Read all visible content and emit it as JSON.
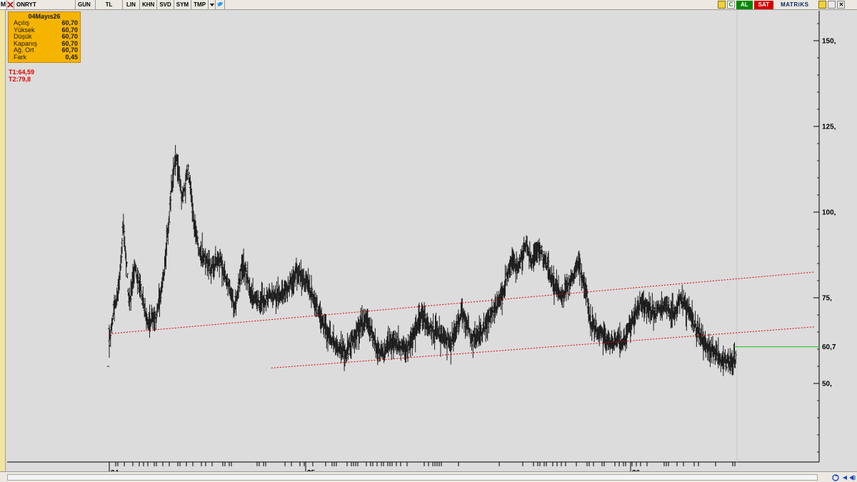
{
  "toolbar": {
    "m_label": "M",
    "symbol": "ONRYT",
    "period": "GUN",
    "currency": "TL",
    "scale": "LIN",
    "buttons": [
      "KHN",
      "SVD",
      "SYM",
      "TMP"
    ],
    "c_label": "C",
    "buy_label": "AL",
    "sell_label": "SAT",
    "brand": "MATRiKS"
  },
  "info_box": {
    "date": "04Mayıs26",
    "rows": [
      {
        "label": "Açılış",
        "value": "60,70"
      },
      {
        "label": "Yüksek",
        "value": "60,70"
      },
      {
        "label": "Düşük",
        "value": "60,70"
      },
      {
        "label": "Kapanış",
        "value": "60,70"
      },
      {
        "label": "Ağ. Ort",
        "value": "60,70"
      },
      {
        "label": "Fark",
        "value": "0,45"
      }
    ]
  },
  "targets": [
    "T1:64,59",
    "T2:79,8"
  ],
  "colors": {
    "bars": "#1a1a1a",
    "trendline": "#e00000",
    "last_price_line": "#22c022",
    "info_box": "#f5b400",
    "buy": "#008a00",
    "sell": "#d80000",
    "background": "#dcdcdc"
  },
  "chart_data": {
    "type": "ohlc",
    "y_ticks": [
      {
        "value": 150,
        "label": "150,"
      },
      {
        "value": 125,
        "label": "125,"
      },
      {
        "value": 100,
        "label": "100,"
      },
      {
        "value": 75,
        "label": "75,"
      },
      {
        "value": 50,
        "label": "50,"
      }
    ],
    "last_price": {
      "value": 60.7,
      "label": "60,7"
    },
    "x_labels": [
      {
        "label": "24",
        "t": 0.0
      },
      {
        "label": "25",
        "t": 1.0
      },
      {
        "label": "26",
        "t": 2.0
      }
    ],
    "ylim": [
      27,
      160
    ],
    "xlim": [
      0.0,
      3.1
    ],
    "price_path": [
      [
        0.0,
        63
      ],
      [
        0.05,
        80
      ],
      [
        0.07,
        97
      ],
      [
        0.1,
        73
      ],
      [
        0.13,
        84
      ],
      [
        0.16,
        76
      ],
      [
        0.19,
        68
      ],
      [
        0.23,
        69
      ],
      [
        0.27,
        82
      ],
      [
        0.31,
        108
      ],
      [
        0.33,
        116
      ],
      [
        0.36,
        103
      ],
      [
        0.39,
        112
      ],
      [
        0.42,
        96
      ],
      [
        0.45,
        88
      ],
      [
        0.5,
        84
      ],
      [
        0.55,
        86
      ],
      [
        0.58,
        80
      ],
      [
        0.62,
        72
      ],
      [
        0.66,
        86
      ],
      [
        0.7,
        76
      ],
      [
        0.74,
        74
      ],
      [
        0.8,
        76
      ],
      [
        0.84,
        75
      ],
      [
        0.88,
        77
      ],
      [
        0.93,
        83
      ],
      [
        0.97,
        80
      ],
      [
        1.02,
        73
      ],
      [
        1.07,
        66
      ],
      [
        1.12,
        61
      ],
      [
        1.17,
        59
      ],
      [
        1.22,
        65
      ],
      [
        1.27,
        69
      ],
      [
        1.31,
        62
      ],
      [
        1.35,
        58
      ],
      [
        1.4,
        63
      ],
      [
        1.44,
        60
      ],
      [
        1.49,
        62
      ],
      [
        1.54,
        70
      ],
      [
        1.59,
        66
      ],
      [
        1.63,
        64
      ],
      [
        1.69,
        62
      ],
      [
        1.74,
        71
      ],
      [
        1.79,
        64
      ],
      [
        1.84,
        65
      ],
      [
        1.89,
        70
      ],
      [
        1.94,
        76
      ],
      [
        1.98,
        85
      ],
      [
        2.02,
        84
      ],
      [
        2.06,
        91
      ],
      [
        2.08,
        85
      ],
      [
        2.12,
        90
      ],
      [
        2.16,
        84
      ],
      [
        2.2,
        79
      ],
      [
        2.24,
        75
      ],
      [
        2.28,
        80
      ],
      [
        2.32,
        85
      ],
      [
        2.36,
        75
      ],
      [
        2.38,
        67
      ],
      [
        2.42,
        65
      ],
      [
        2.46,
        62
      ],
      [
        2.5,
        63
      ],
      [
        2.54,
        62
      ],
      [
        2.58,
        68
      ],
      [
        2.62,
        73
      ],
      [
        2.66,
        72
      ],
      [
        2.7,
        71
      ],
      [
        2.74,
        73
      ],
      [
        2.78,
        70
      ],
      [
        2.82,
        75
      ],
      [
        2.86,
        71
      ],
      [
        2.9,
        66
      ],
      [
        2.94,
        61
      ],
      [
        2.98,
        60
      ],
      [
        3.02,
        57
      ],
      [
        3.06,
        56
      ],
      [
        3.1,
        57
      ],
      [
        3.14,
        60
      ],
      [
        3.18,
        62
      ],
      [
        3.22,
        61
      ],
      [
        3.26,
        60.7
      ]
    ],
    "trendlines": [
      {
        "x1": 0.0,
        "y1": 64.5,
        "x2": 3.48,
        "y2": 82.5
      },
      {
        "x1": 0.8,
        "y1": 54.5,
        "x2": 3.48,
        "y2": 66.5
      }
    ],
    "volume_ticks": true
  }
}
